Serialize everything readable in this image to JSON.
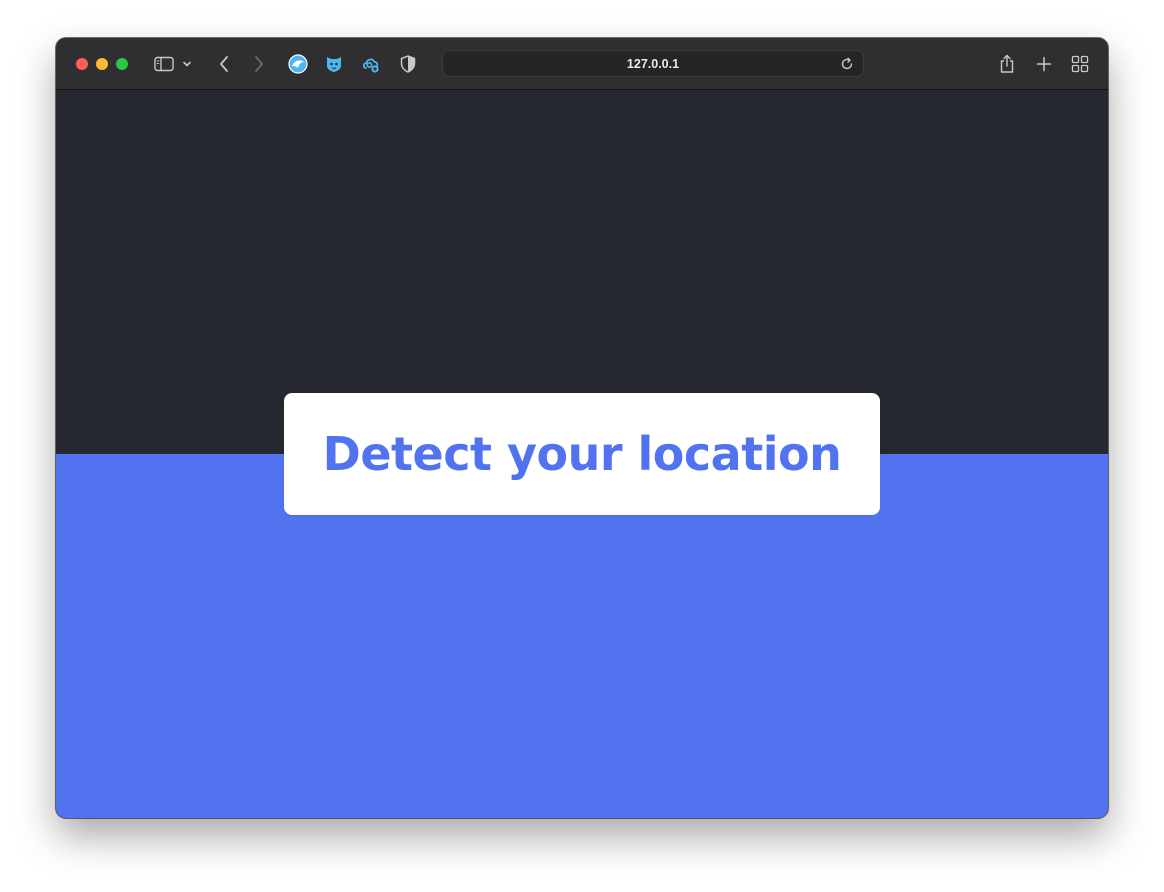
{
  "browser": {
    "url": "127.0.0.1",
    "toolbar_color": "#2f2f31"
  },
  "page": {
    "top_color": "#25282f",
    "bottom_color": "#5273ef",
    "button_label": "Detect your location",
    "button_text_color": "#5273ef"
  },
  "icons": [
    "sidebar-icon",
    "chevron-down-icon",
    "back-icon",
    "forward-icon",
    "extension-globe-icon",
    "extension-shield-cat-icon",
    "extension-cloud-icon",
    "privacy-shield-icon",
    "reload-icon",
    "share-icon",
    "new-tab-icon",
    "tab-overview-icon"
  ]
}
